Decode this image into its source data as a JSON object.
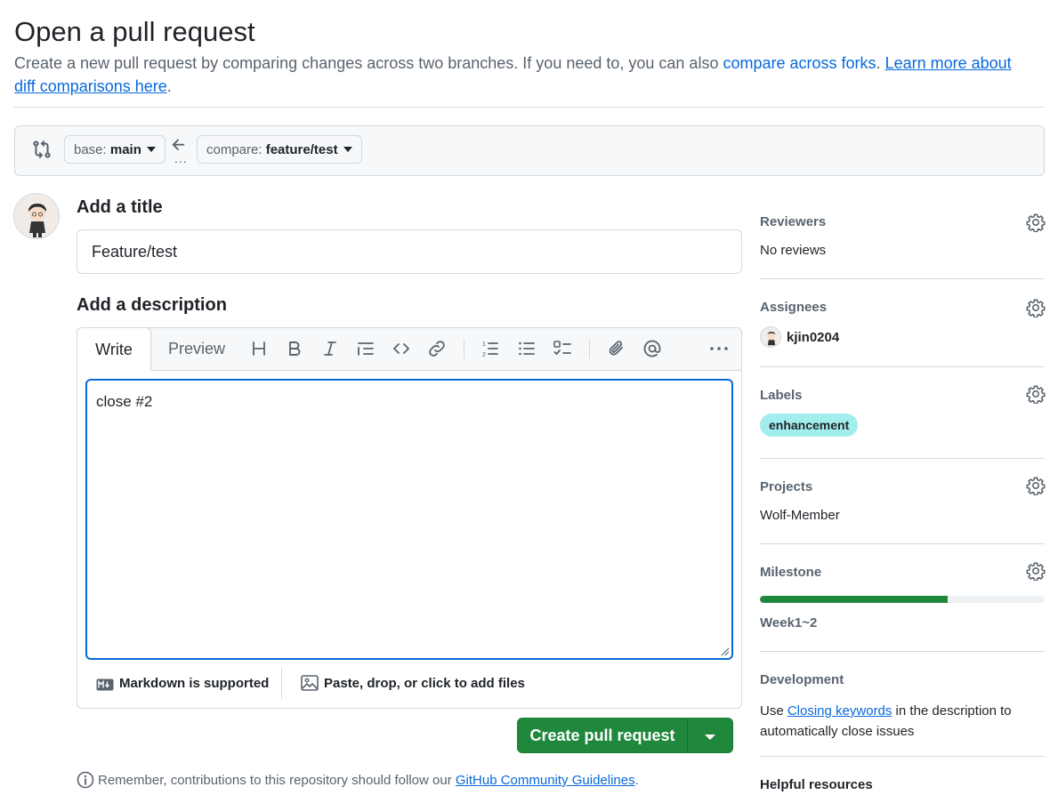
{
  "header": {
    "title": "Open a pull request",
    "subtitle_text": "Create a new pull request by comparing changes across two branches. If you need to, you can also ",
    "compare_forks_link": "compare across forks",
    "period": ".",
    "learn_more_link": "Learn more about diff comparisons here",
    "end": "."
  },
  "compare": {
    "base_prefix": "base: ",
    "base_branch": "main",
    "compare_prefix": "compare: ",
    "compare_branch": "feature/test",
    "dots": "..."
  },
  "form": {
    "title_label": "Add a title",
    "title_value": "Feature/test",
    "description_label": "Add a description",
    "tabs": {
      "write": "Write",
      "preview": "Preview"
    },
    "body_value": "close #2",
    "markdown_note": "Markdown is supported",
    "attach_note": "Paste, drop, or click to add files",
    "create_button": "Create pull request"
  },
  "footer": {
    "remember_text": "Remember, contributions to this repository should follow our ",
    "guidelines_link": "GitHub Community Guidelines",
    "end": "."
  },
  "sidebar": {
    "reviewers": {
      "label": "Reviewers",
      "value": "No reviews"
    },
    "assignees": {
      "label": "Assignees",
      "user": "kjin0204"
    },
    "labels": {
      "label": "Labels",
      "tag": "enhancement",
      "tag_color": "#a2eeef"
    },
    "projects": {
      "label": "Projects",
      "value": "Wolf-Member"
    },
    "milestone": {
      "label": "Milestone",
      "name": "Week1~2",
      "progress_percent": 66
    },
    "development": {
      "label": "Development",
      "text_before": "Use ",
      "link": "Closing keywords",
      "text_after": " in the description to automatically close issues"
    },
    "helpful": {
      "label": "Helpful resources"
    }
  },
  "colors": {
    "primary_button": "#1f883d",
    "link": "#0969da",
    "focus_border": "#0969da"
  },
  "icons": [
    "git-compare-icon",
    "arrow-left-icon",
    "heading-icon",
    "bold-icon",
    "italic-icon",
    "quote-icon",
    "code-icon",
    "link-icon",
    "ordered-list-icon",
    "unordered-list-icon",
    "task-list-icon",
    "paperclip-icon",
    "mention-icon",
    "kebab-icon",
    "markdown-icon",
    "image-icon",
    "info-icon",
    "gear-icon"
  ]
}
